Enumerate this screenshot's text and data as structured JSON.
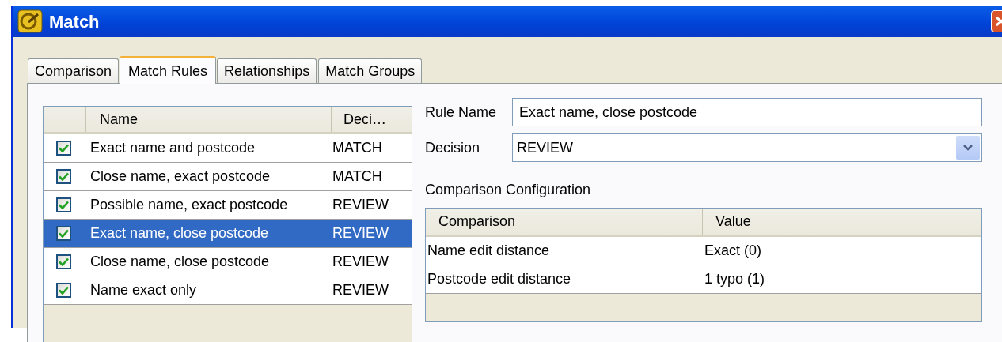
{
  "window": {
    "title": "Match"
  },
  "tabs": [
    {
      "label": "Comparison",
      "selected": false
    },
    {
      "label": "Match Rules",
      "selected": true
    },
    {
      "label": "Relationships",
      "selected": false
    },
    {
      "label": "Match Groups",
      "selected": false
    }
  ],
  "rules_table": {
    "columns": [
      "Name",
      "Deci…"
    ],
    "rows": [
      {
        "name": "Exact name and postcode",
        "decision": "MATCH",
        "checked": true,
        "selected": false
      },
      {
        "name": "Close name, exact postcode",
        "decision": "MATCH",
        "checked": true,
        "selected": false
      },
      {
        "name": "Possible name, exact postcode",
        "decision": "REVIEW",
        "checked": true,
        "selected": false
      },
      {
        "name": "Exact name, close postcode",
        "decision": "REVIEW",
        "checked": true,
        "selected": true
      },
      {
        "name": "Close name, close postcode",
        "decision": "REVIEW",
        "checked": true,
        "selected": false
      },
      {
        "name": "Name exact only",
        "decision": "REVIEW",
        "checked": true,
        "selected": false
      }
    ]
  },
  "rule_name": {
    "label": "Rule Name",
    "value": "Exact name, close postcode"
  },
  "decision": {
    "label": "Decision",
    "value": "REVIEW"
  },
  "comparison_configuration": {
    "title": "Comparison Configuration",
    "columns": [
      "Comparison",
      "Value"
    ],
    "rows": [
      {
        "comparison": "Name edit distance",
        "value": "Exact (0)"
      },
      {
        "comparison": "Postcode edit distance",
        "value": "1 typo (1)"
      }
    ]
  }
}
